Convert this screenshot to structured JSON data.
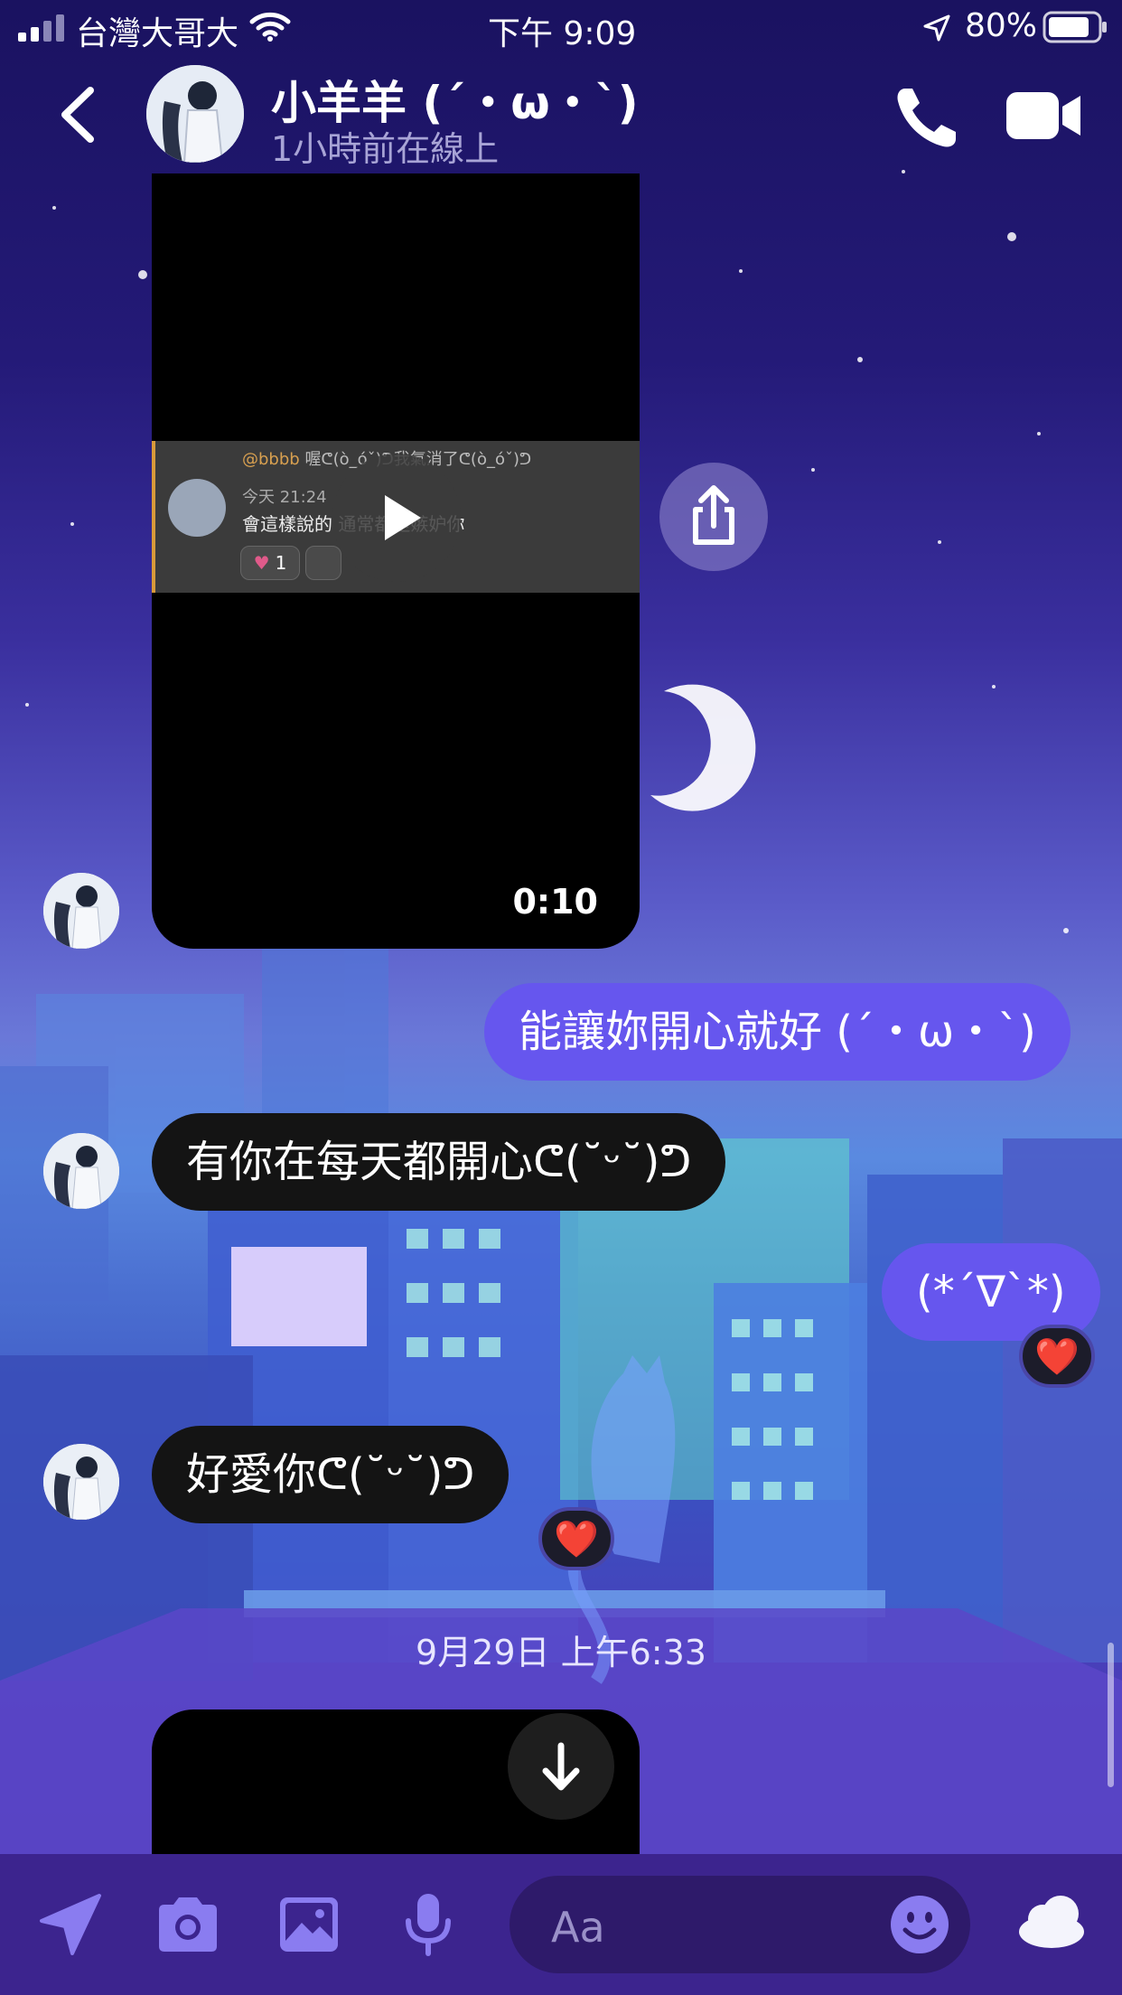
{
  "status_bar": {
    "carrier": "台灣大哥大",
    "time": "下午 9:09",
    "battery_percent": "80%"
  },
  "header": {
    "contact_name": "小羊羊 (´・ω・`)",
    "contact_status": "1小時前在線上"
  },
  "video_message": {
    "duration": "0:10",
    "preview": {
      "reply_user": "@bbbb",
      "reply_text": "喔ᕦ(ò_óˇ)ᕤ我氣消了ᕦ(ò_óˇ)ᕤ",
      "time_label": "今天 21:24",
      "message_text": "會這樣說的 通常都是嫉妒你",
      "reaction_count": "1"
    }
  },
  "messages": [
    {
      "direction": "out",
      "text": "能讓妳開心就好 (´・ω・`)"
    },
    {
      "direction": "in",
      "text": "有你在每天都開心ᕦ(˘ᵕ˘)ᕤ"
    },
    {
      "direction": "out",
      "text": "(*´∇`*)",
      "reaction": "❤️"
    },
    {
      "direction": "in",
      "text": "好愛你ᕦ(˘ᵕ˘)ᕤ",
      "reaction": "❤️"
    }
  ],
  "timestamp_divider": "9月29日 上午6:33",
  "composer": {
    "placeholder": "Aa"
  },
  "colors": {
    "accent": "#6656ee",
    "incoming_bubble": "#141414",
    "composer_bg": "#3c248e"
  },
  "icons": [
    "signal-icon",
    "wifi-icon",
    "location-arrow-icon",
    "battery-icon",
    "chevron-left-icon",
    "phone-icon",
    "video-camera-icon",
    "play-icon",
    "share-icon",
    "arrow-down-icon",
    "send-location-icon",
    "camera-icon",
    "image-icon",
    "microphone-icon",
    "smiley-icon",
    "cloud-icon"
  ]
}
